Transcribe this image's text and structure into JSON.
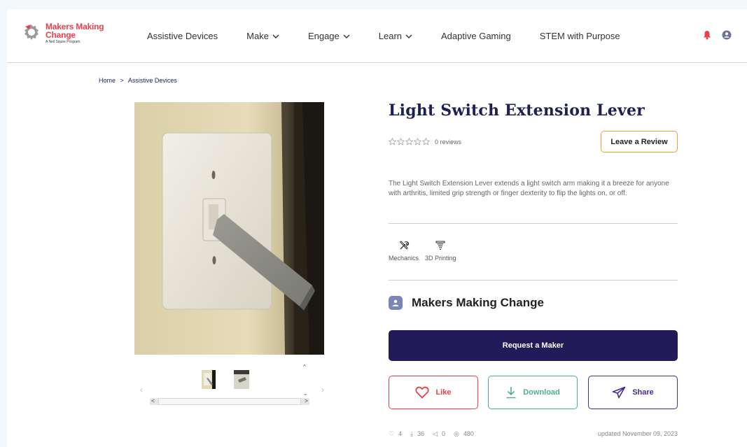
{
  "header": {
    "logo": {
      "line1": "Makers Making",
      "line2": "Change",
      "tagline": "A Neil Squire Program"
    },
    "nav": [
      {
        "label": "Assistive Devices",
        "dropdown": false
      },
      {
        "label": "Make",
        "dropdown": true
      },
      {
        "label": "Engage",
        "dropdown": true
      },
      {
        "label": "Learn",
        "dropdown": true
      },
      {
        "label": "Adaptive Gaming",
        "dropdown": false
      },
      {
        "label": "STEM with Purpose",
        "dropdown": false
      }
    ],
    "icons": [
      "bell-icon",
      "user-icon"
    ]
  },
  "breadcrumb": {
    "home": "Home",
    "separator": ">",
    "current": "Assistive Devices"
  },
  "product": {
    "title": "Light Switch Extension Lever",
    "rating": 0,
    "reviews_label": "0 reviews",
    "review_button": "Leave a Review",
    "description": "The Light Switch Extension Lever extends a light switch arm making it a breeze for anyone with arthritis, limited grip strength or finger dexterity to flip the lights on, or off.",
    "categories": [
      {
        "label": "Mechanics",
        "icon": "tools-icon"
      },
      {
        "label": "3D Printing",
        "icon": "3d-printer-icon"
      }
    ],
    "maker": {
      "name": "Makers Making Change",
      "icon": "user-badge-icon"
    },
    "request_button": "Request a Maker",
    "actions": {
      "like": "Like",
      "download": "Download",
      "share": "Share"
    },
    "stats": {
      "likes": "4",
      "downloads": "36",
      "shares": "0",
      "views": "480"
    },
    "updated": "updated November 09, 2023"
  },
  "gallery": {
    "thumbnails": 2,
    "prev_icon": "chevron-left-icon",
    "next_icon": "chevron-right-icon"
  },
  "colors": {
    "brand_red": "#e8414d",
    "title_navy": "#1d2051",
    "request_bg": "#231a5a",
    "download_green": "#4caf95",
    "share_purple": "#4b2a8a",
    "review_border": "#e6a331"
  }
}
